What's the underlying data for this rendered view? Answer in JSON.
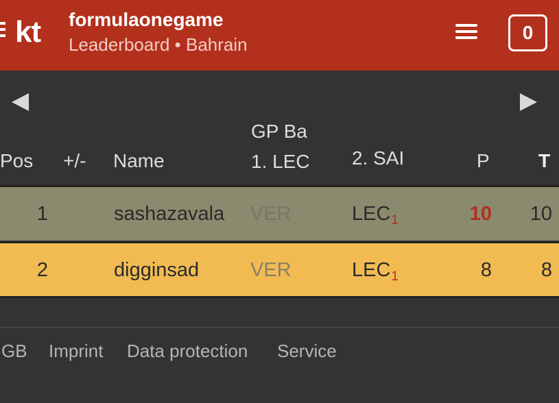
{
  "header": {
    "logo_text": "kt",
    "title": "formulaonegame",
    "subtitle": "Leaderboard • Bahrain",
    "counter": "0",
    "icons": {
      "menu": "hamburger-icon",
      "logo_bars": "menu-bars-icon"
    }
  },
  "nav": {
    "prev_icon": "triangle-left-icon",
    "next_icon": "triangle-right-icon"
  },
  "table": {
    "headers": {
      "pos": "Pos",
      "delta": "+/-",
      "name": "Name",
      "gp_line1": "GP Ba",
      "gp_line2": "1. LEC",
      "tip2": "2. SAI",
      "points": "P",
      "total": "T"
    },
    "rows": [
      {
        "pos": "1",
        "name": "sashazavala",
        "tip1": "VER",
        "tip2": "LEC",
        "tip2_sub": "1",
        "points": "10",
        "total": "10"
      },
      {
        "pos": "2",
        "name": "digginsad",
        "tip1": "VER",
        "tip2": "LEC",
        "tip2_sub": "1",
        "points": "8",
        "total": "8"
      }
    ]
  },
  "footer": {
    "links": [
      "GB",
      "Imprint",
      "Data protection",
      "Service"
    ]
  },
  "colors": {
    "brand": "#b3301c",
    "background": "#333333",
    "row_1": "#8a8a6e",
    "row_2": "#f2bb52"
  }
}
